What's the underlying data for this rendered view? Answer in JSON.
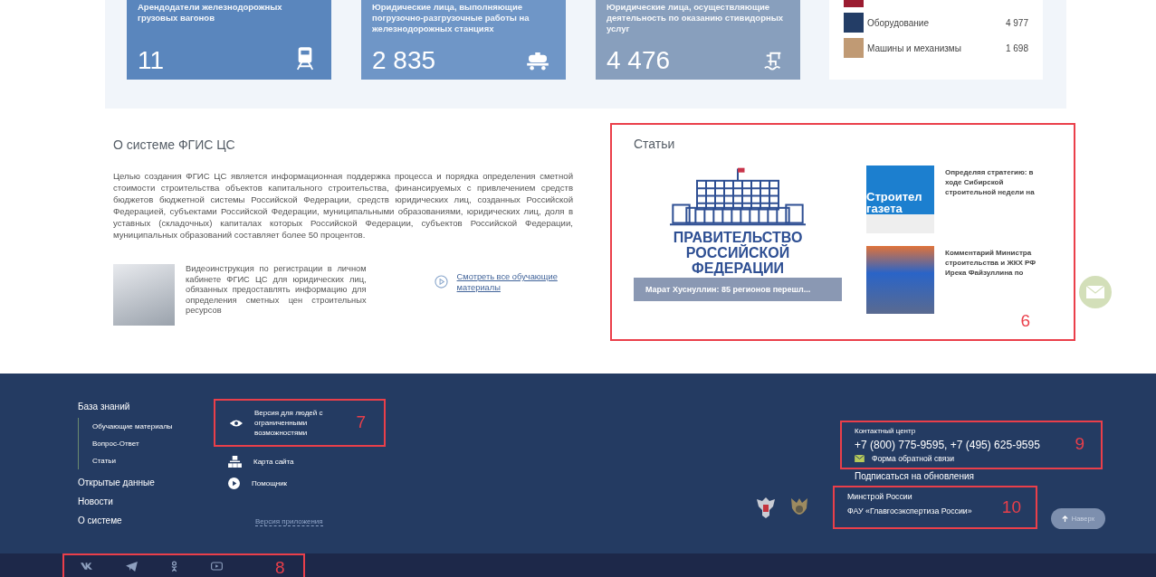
{
  "stats": {
    "cards": [
      {
        "title": "Арендодатели железнодорожных грузовых вагонов",
        "value": "11",
        "kind": "train",
        "color": "#5a86bd"
      },
      {
        "title": "Юридические лица, выполняющие погрузочно-разгрузочные работы на железнодорожных станциях",
        "value": "2 835",
        "kind": "tank",
        "color": "#6f96c7"
      },
      {
        "title": "Юридические лица, осуществляющие деятельность по оказанию стивидорных услуг",
        "value": "4 476",
        "kind": "crane",
        "color": "#889fbd"
      }
    ],
    "legend": [
      {
        "color": "#9b1c31"
      },
      {
        "label": "Оборудование",
        "value": "4 977",
        "color": "#233d66"
      },
      {
        "label": "Машины и механизмы",
        "value": "1 698",
        "color": "#c09a74"
      }
    ]
  },
  "about": {
    "title": "О системе ФГИС ЦС",
    "text": "Целью создания ФГИС ЦС является информационная поддержка процесса и порядка определения сметной стоимости строительства объектов капитального строительства, финансируемых с привлечением средств бюджетов бюджетной системы Российской Федерации, средств юридических лиц, созданных Российской Федерацией, субъектами Российской Федерации, муниципальными образованиями, юридических лиц, доля в уставных (складочных) капиталах которых Российской Федерации, субъектов Российской Федерации, муниципальных образований составляет более 50 процентов.",
    "video_text": "Видеоинструкция по регистрации в личном кабинете ФГИС ЦС для юридических лиц, обязанных предоставлять информацию для определения сметных цен строительных ресурсов",
    "all_link": "Смотреть все обучающие материалы"
  },
  "articles": {
    "title": "Статьи",
    "annotation": "6",
    "main": {
      "logo_lines": [
        "ПРАВИТЕЛЬСТВО",
        "РОССИЙСКОЙ",
        "ФЕДЕРАЦИИ"
      ],
      "caption": "Марат Хуснуллин: 85 регионов перешл..."
    },
    "items": [
      {
        "title": "Определяя стратегию: в ходе Сибирской строительной недели на",
        "kind": "newspaper",
        "image_text": [
          "Строител",
          "газета"
        ]
      },
      {
        "title": "Комментарий Министра строительства и ЖКХ РФ Ирека Файзуллина по",
        "kind": "photo"
      }
    ]
  },
  "footer": {
    "nav": [
      {
        "label": "База знаний",
        "children": [
          {
            "label": "Обучающие материалы"
          },
          {
            "label": "Вопрос-Ответ"
          },
          {
            "label": "Статьи"
          }
        ]
      },
      {
        "label": "Открытые данные"
      },
      {
        "label": "Новости"
      },
      {
        "label": "О системе"
      }
    ],
    "links": [
      {
        "label": "Версия для людей с ограниченными возможностями",
        "kind": "eye",
        "annotation": "7"
      },
      {
        "label": "Карта сайта",
        "kind": "sitemap"
      },
      {
        "label": "Помощник",
        "kind": "play"
      }
    ],
    "app_version": "Версия приложения",
    "contact": {
      "title": "Контактный центр",
      "phones": "+7 (800) 775-9595, +7 (495) 625-9595",
      "feedback": "Форма обратной связи",
      "annotation": "9"
    },
    "subscribe": "Подписаться на обновления",
    "orgs": {
      "lines": [
        "Минстрой России",
        "ФАУ «Главгосэкспертиза России»"
      ],
      "annotation": "10"
    },
    "to_top": "Наверх",
    "social": {
      "icons": [
        {
          "kind": "vk"
        },
        {
          "kind": "telegram"
        },
        {
          "kind": "ok"
        },
        {
          "kind": "youtube"
        }
      ],
      "annotation": "8"
    }
  }
}
